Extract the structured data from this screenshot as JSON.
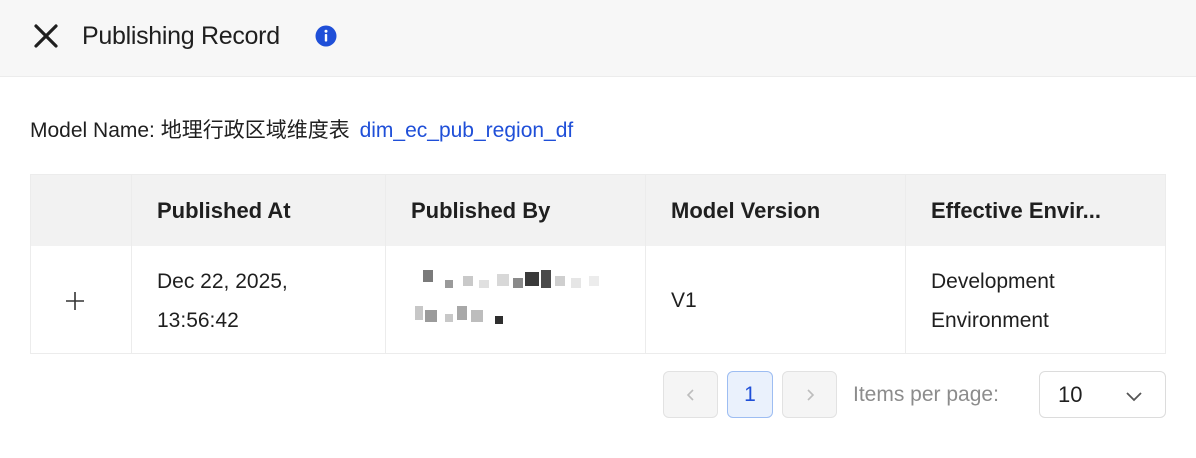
{
  "header": {
    "title": "Publishing Record"
  },
  "model": {
    "label": "Model Name:",
    "chinese_name": "地理行政区域维度表",
    "table_name": "dim_ec_pub_region_df"
  },
  "table": {
    "columns": [
      "",
      "Published At",
      "Published By",
      "Model Version",
      "Effective Envir..."
    ],
    "rows": [
      {
        "published_at_line1": "Dec 22, 2025,",
        "published_at_line2": "13:56:42",
        "published_by": "",
        "model_version": "V1",
        "environment_line1": "Development",
        "environment_line2": "Environment"
      }
    ]
  },
  "pagination": {
    "current_page": "1",
    "items_per_page_label": "Items per page:",
    "items_per_page_value": "10"
  },
  "icons": {
    "close": "close-icon",
    "info": "info-icon",
    "expand": "plus-icon",
    "prev": "chevron-left-icon",
    "next": "chevron-right-icon",
    "dropdown": "chevron-down-icon"
  },
  "colors": {
    "accent": "#1f4fd8",
    "header_bg": "#f7f7f7",
    "table_header_bg": "#f2f2f2"
  }
}
